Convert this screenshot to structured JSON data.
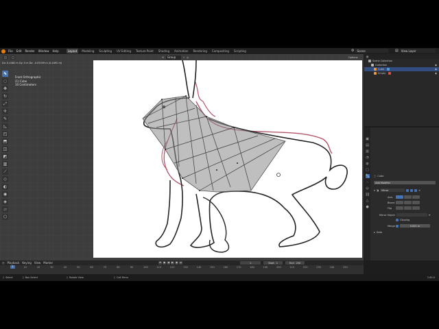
{
  "menu": [
    "File",
    "Edit",
    "Render",
    "Window",
    "Help"
  ],
  "workspaces": [
    "Layout",
    "Modeling",
    "Sculpting",
    "UV Editing",
    "Texture Paint",
    "Shading",
    "Animation",
    "Rendering",
    "Compositing",
    "Scripting"
  ],
  "scene": "Scene",
  "view_layer": "View Layer",
  "viewport": {
    "status_line": "Dx: 0.4482 m  Dy: 0 m  Dz: -0.03039 m (0.4492 m)",
    "mode": "Group",
    "options": "Options",
    "info": [
      "Front Orthographic",
      "(1) Cube",
      "10 Centimeters"
    ]
  },
  "outliner": {
    "items": [
      "Scene Collection",
      "Collection",
      "Cube",
      "Empty"
    ]
  },
  "properties": {
    "object_name": "Cube",
    "add_modifier": "Add Modifier",
    "modifier_name": "Mirror",
    "labels": {
      "axis": "Axis",
      "bisect": "Bisect",
      "flip": "Flip",
      "mirror_object": "Mirror Object",
      "clipping": "Clipping",
      "merge": "Merge",
      "data": "Data"
    },
    "axes": [
      "X",
      "Y",
      "Z"
    ],
    "merge_value": "0.001 m"
  },
  "timeline": {
    "menus": [
      "Playback",
      "Keying",
      "View",
      "Marker"
    ],
    "current_frame": "1",
    "start_label": "Start",
    "start": "1",
    "end_label": "End",
    "end": "250",
    "ticks": [
      "0",
      "10",
      "20",
      "30",
      "40",
      "50",
      "60",
      "70",
      "80",
      "90",
      "100",
      "110",
      "120",
      "130",
      "140",
      "150",
      "160",
      "170",
      "180",
      "190",
      "200",
      "210",
      "220",
      "230",
      "240",
      "250"
    ]
  },
  "statusbar": {
    "select": "Select",
    "box_select": "Box Select",
    "rotate_view": "Rotate View",
    "call_menu": "Call Menu",
    "version": "2.80.0"
  },
  "colors": {
    "accent": "#4772b3",
    "blender_orange": "#e87d0d"
  }
}
